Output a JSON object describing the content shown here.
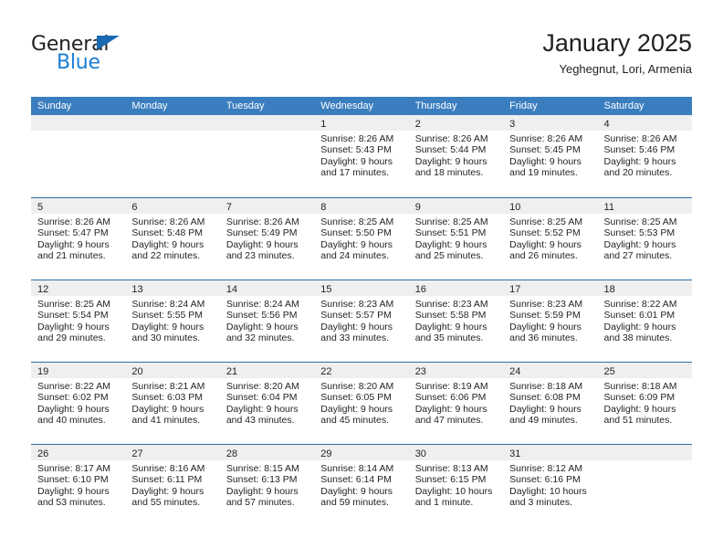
{
  "brand": {
    "name_part1": "General",
    "name_part2": "Blue",
    "accent_color": "#1b7fd4",
    "triangle_color": "#1b69b0"
  },
  "header": {
    "title": "January 2025",
    "subtitle": "Yeghegnut, Lori, Armenia"
  },
  "calendar": {
    "header_bg": "#3a7ebf",
    "daynum_band_bg": "#efefef",
    "week_rule_color": "#2f6da8",
    "weekdays": [
      "Sunday",
      "Monday",
      "Tuesday",
      "Wednesday",
      "Thursday",
      "Friday",
      "Saturday"
    ],
    "weeks": [
      [
        {
          "day": "",
          "lines": []
        },
        {
          "day": "",
          "lines": []
        },
        {
          "day": "",
          "lines": []
        },
        {
          "day": "1",
          "lines": [
            "Sunrise: 8:26 AM",
            "Sunset: 5:43 PM",
            "Daylight: 9 hours",
            "and 17 minutes."
          ]
        },
        {
          "day": "2",
          "lines": [
            "Sunrise: 8:26 AM",
            "Sunset: 5:44 PM",
            "Daylight: 9 hours",
            "and 18 minutes."
          ]
        },
        {
          "day": "3",
          "lines": [
            "Sunrise: 8:26 AM",
            "Sunset: 5:45 PM",
            "Daylight: 9 hours",
            "and 19 minutes."
          ]
        },
        {
          "day": "4",
          "lines": [
            "Sunrise: 8:26 AM",
            "Sunset: 5:46 PM",
            "Daylight: 9 hours",
            "and 20 minutes."
          ]
        }
      ],
      [
        {
          "day": "5",
          "lines": [
            "Sunrise: 8:26 AM",
            "Sunset: 5:47 PM",
            "Daylight: 9 hours",
            "and 21 minutes."
          ]
        },
        {
          "day": "6",
          "lines": [
            "Sunrise: 8:26 AM",
            "Sunset: 5:48 PM",
            "Daylight: 9 hours",
            "and 22 minutes."
          ]
        },
        {
          "day": "7",
          "lines": [
            "Sunrise: 8:26 AM",
            "Sunset: 5:49 PM",
            "Daylight: 9 hours",
            "and 23 minutes."
          ]
        },
        {
          "day": "8",
          "lines": [
            "Sunrise: 8:25 AM",
            "Sunset: 5:50 PM",
            "Daylight: 9 hours",
            "and 24 minutes."
          ]
        },
        {
          "day": "9",
          "lines": [
            "Sunrise: 8:25 AM",
            "Sunset: 5:51 PM",
            "Daylight: 9 hours",
            "and 25 minutes."
          ]
        },
        {
          "day": "10",
          "lines": [
            "Sunrise: 8:25 AM",
            "Sunset: 5:52 PM",
            "Daylight: 9 hours",
            "and 26 minutes."
          ]
        },
        {
          "day": "11",
          "lines": [
            "Sunrise: 8:25 AM",
            "Sunset: 5:53 PM",
            "Daylight: 9 hours",
            "and 27 minutes."
          ]
        }
      ],
      [
        {
          "day": "12",
          "lines": [
            "Sunrise: 8:25 AM",
            "Sunset: 5:54 PM",
            "Daylight: 9 hours",
            "and 29 minutes."
          ]
        },
        {
          "day": "13",
          "lines": [
            "Sunrise: 8:24 AM",
            "Sunset: 5:55 PM",
            "Daylight: 9 hours",
            "and 30 minutes."
          ]
        },
        {
          "day": "14",
          "lines": [
            "Sunrise: 8:24 AM",
            "Sunset: 5:56 PM",
            "Daylight: 9 hours",
            "and 32 minutes."
          ]
        },
        {
          "day": "15",
          "lines": [
            "Sunrise: 8:23 AM",
            "Sunset: 5:57 PM",
            "Daylight: 9 hours",
            "and 33 minutes."
          ]
        },
        {
          "day": "16",
          "lines": [
            "Sunrise: 8:23 AM",
            "Sunset: 5:58 PM",
            "Daylight: 9 hours",
            "and 35 minutes."
          ]
        },
        {
          "day": "17",
          "lines": [
            "Sunrise: 8:23 AM",
            "Sunset: 5:59 PM",
            "Daylight: 9 hours",
            "and 36 minutes."
          ]
        },
        {
          "day": "18",
          "lines": [
            "Sunrise: 8:22 AM",
            "Sunset: 6:01 PM",
            "Daylight: 9 hours",
            "and 38 minutes."
          ]
        }
      ],
      [
        {
          "day": "19",
          "lines": [
            "Sunrise: 8:22 AM",
            "Sunset: 6:02 PM",
            "Daylight: 9 hours",
            "and 40 minutes."
          ]
        },
        {
          "day": "20",
          "lines": [
            "Sunrise: 8:21 AM",
            "Sunset: 6:03 PM",
            "Daylight: 9 hours",
            "and 41 minutes."
          ]
        },
        {
          "day": "21",
          "lines": [
            "Sunrise: 8:20 AM",
            "Sunset: 6:04 PM",
            "Daylight: 9 hours",
            "and 43 minutes."
          ]
        },
        {
          "day": "22",
          "lines": [
            "Sunrise: 8:20 AM",
            "Sunset: 6:05 PM",
            "Daylight: 9 hours",
            "and 45 minutes."
          ]
        },
        {
          "day": "23",
          "lines": [
            "Sunrise: 8:19 AM",
            "Sunset: 6:06 PM",
            "Daylight: 9 hours",
            "and 47 minutes."
          ]
        },
        {
          "day": "24",
          "lines": [
            "Sunrise: 8:18 AM",
            "Sunset: 6:08 PM",
            "Daylight: 9 hours",
            "and 49 minutes."
          ]
        },
        {
          "day": "25",
          "lines": [
            "Sunrise: 8:18 AM",
            "Sunset: 6:09 PM",
            "Daylight: 9 hours",
            "and 51 minutes."
          ]
        }
      ],
      [
        {
          "day": "26",
          "lines": [
            "Sunrise: 8:17 AM",
            "Sunset: 6:10 PM",
            "Daylight: 9 hours",
            "and 53 minutes."
          ]
        },
        {
          "day": "27",
          "lines": [
            "Sunrise: 8:16 AM",
            "Sunset: 6:11 PM",
            "Daylight: 9 hours",
            "and 55 minutes."
          ]
        },
        {
          "day": "28",
          "lines": [
            "Sunrise: 8:15 AM",
            "Sunset: 6:13 PM",
            "Daylight: 9 hours",
            "and 57 minutes."
          ]
        },
        {
          "day": "29",
          "lines": [
            "Sunrise: 8:14 AM",
            "Sunset: 6:14 PM",
            "Daylight: 9 hours",
            "and 59 minutes."
          ]
        },
        {
          "day": "30",
          "lines": [
            "Sunrise: 8:13 AM",
            "Sunset: 6:15 PM",
            "Daylight: 10 hours",
            "and 1 minute."
          ]
        },
        {
          "day": "31",
          "lines": [
            "Sunrise: 8:12 AM",
            "Sunset: 6:16 PM",
            "Daylight: 10 hours",
            "and 3 minutes."
          ]
        },
        {
          "day": "",
          "lines": []
        }
      ]
    ]
  }
}
